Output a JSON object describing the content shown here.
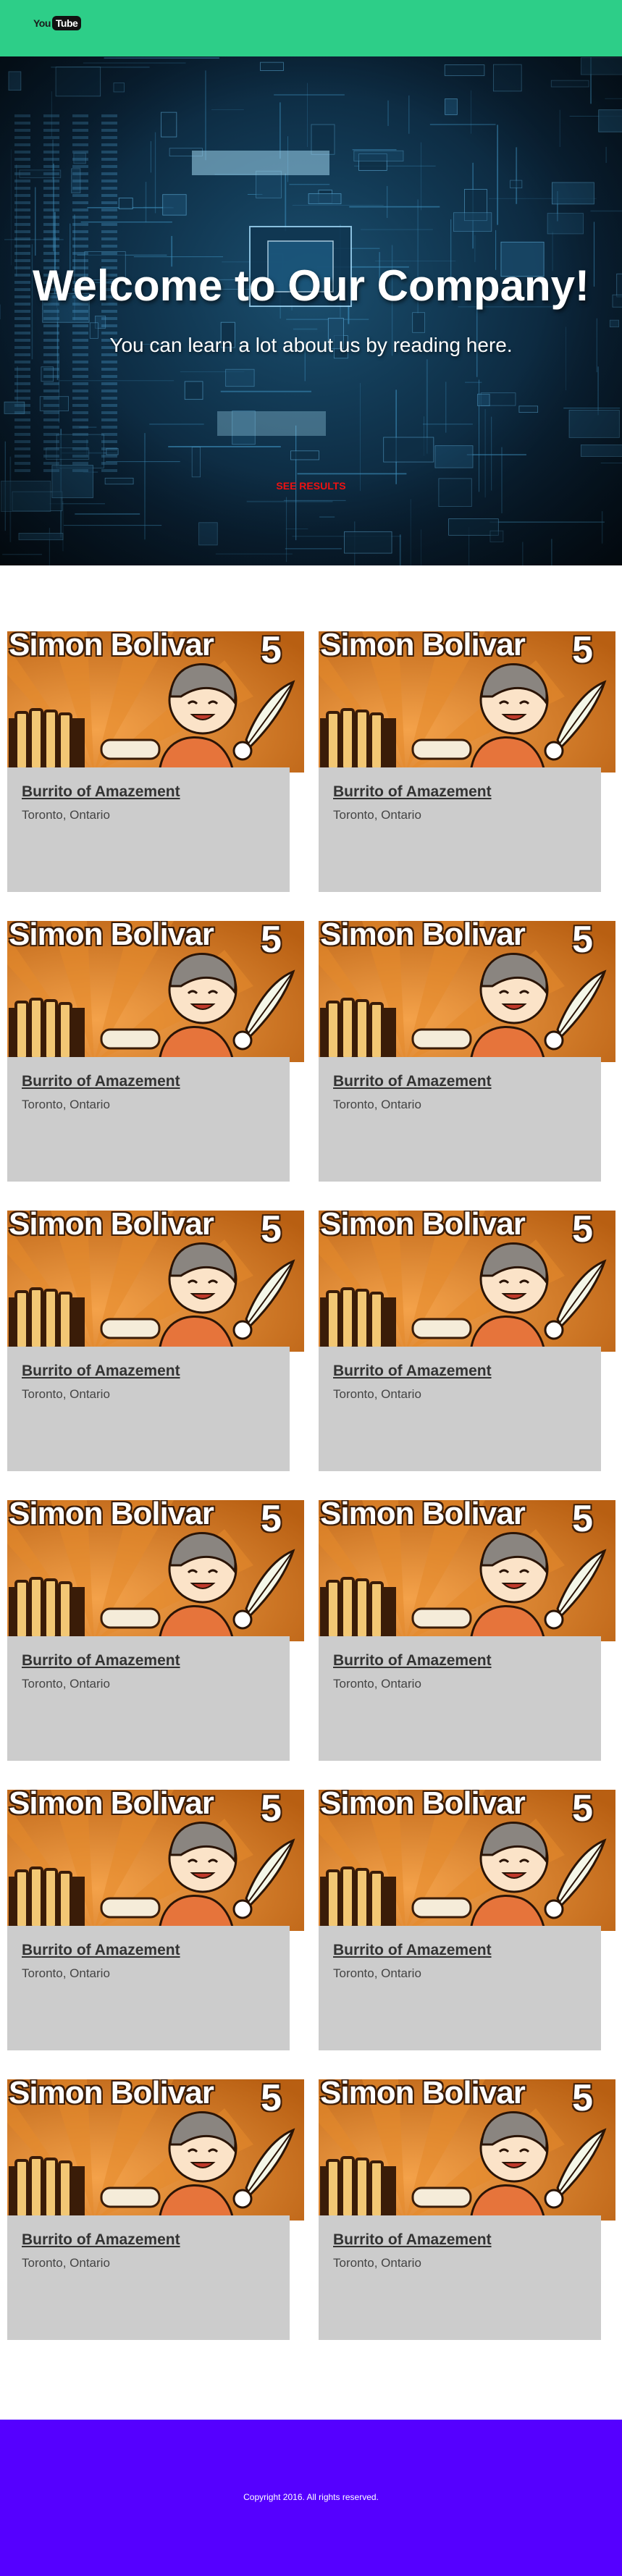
{
  "header": {
    "logo_you": "You",
    "logo_tube": "Tube",
    "bg_color": "#2dce88"
  },
  "hero": {
    "title": "Welcome to Our Company!",
    "subtitle": "You can learn a lot about us by reading here.",
    "link_label": "SEE RESULTS",
    "link_color": "#ee1111"
  },
  "cards": [
    {
      "image_text": "Simon Bolivar",
      "image_number": "5",
      "title": "Burrito of Amazement",
      "location": "Toronto, Ontario"
    },
    {
      "image_text": "Simon Bolivar",
      "image_number": "5",
      "title": "Burrito of Amazement",
      "location": "Toronto, Ontario"
    },
    {
      "image_text": "Simon Bolivar",
      "image_number": "5",
      "title": "Burrito of Amazement",
      "location": "Toronto, Ontario"
    },
    {
      "image_text": "Simon Bolivar",
      "image_number": "5",
      "title": "Burrito of Amazement",
      "location": "Toronto, Ontario"
    },
    {
      "image_text": "Simon Bolivar",
      "image_number": "5",
      "title": "Burrito of Amazement",
      "location": "Toronto, Ontario"
    },
    {
      "image_text": "Simon Bolivar",
      "image_number": "5",
      "title": "Burrito of Amazement",
      "location": "Toronto, Ontario"
    },
    {
      "image_text": "Simon Bolivar",
      "image_number": "5",
      "title": "Burrito of Amazement",
      "location": "Toronto, Ontario"
    },
    {
      "image_text": "Simon Bolivar",
      "image_number": "5",
      "title": "Burrito of Amazement",
      "location": "Toronto, Ontario"
    },
    {
      "image_text": "Simon Bolivar",
      "image_number": "5",
      "title": "Burrito of Amazement",
      "location": "Toronto, Ontario"
    },
    {
      "image_text": "Simon Bolivar",
      "image_number": "5",
      "title": "Burrito of Amazement",
      "location": "Toronto, Ontario"
    },
    {
      "image_text": "Simon Bolivar",
      "image_number": "5",
      "title": "Burrito of Amazement",
      "location": "Toronto, Ontario"
    },
    {
      "image_text": "Simon Bolivar",
      "image_number": "5",
      "title": "Burrito of Amazement",
      "location": "Toronto, Ontario"
    }
  ],
  "footer": {
    "copyright": "Copyright 2016. All rights reserved.",
    "bg_color": "#5500ff"
  }
}
